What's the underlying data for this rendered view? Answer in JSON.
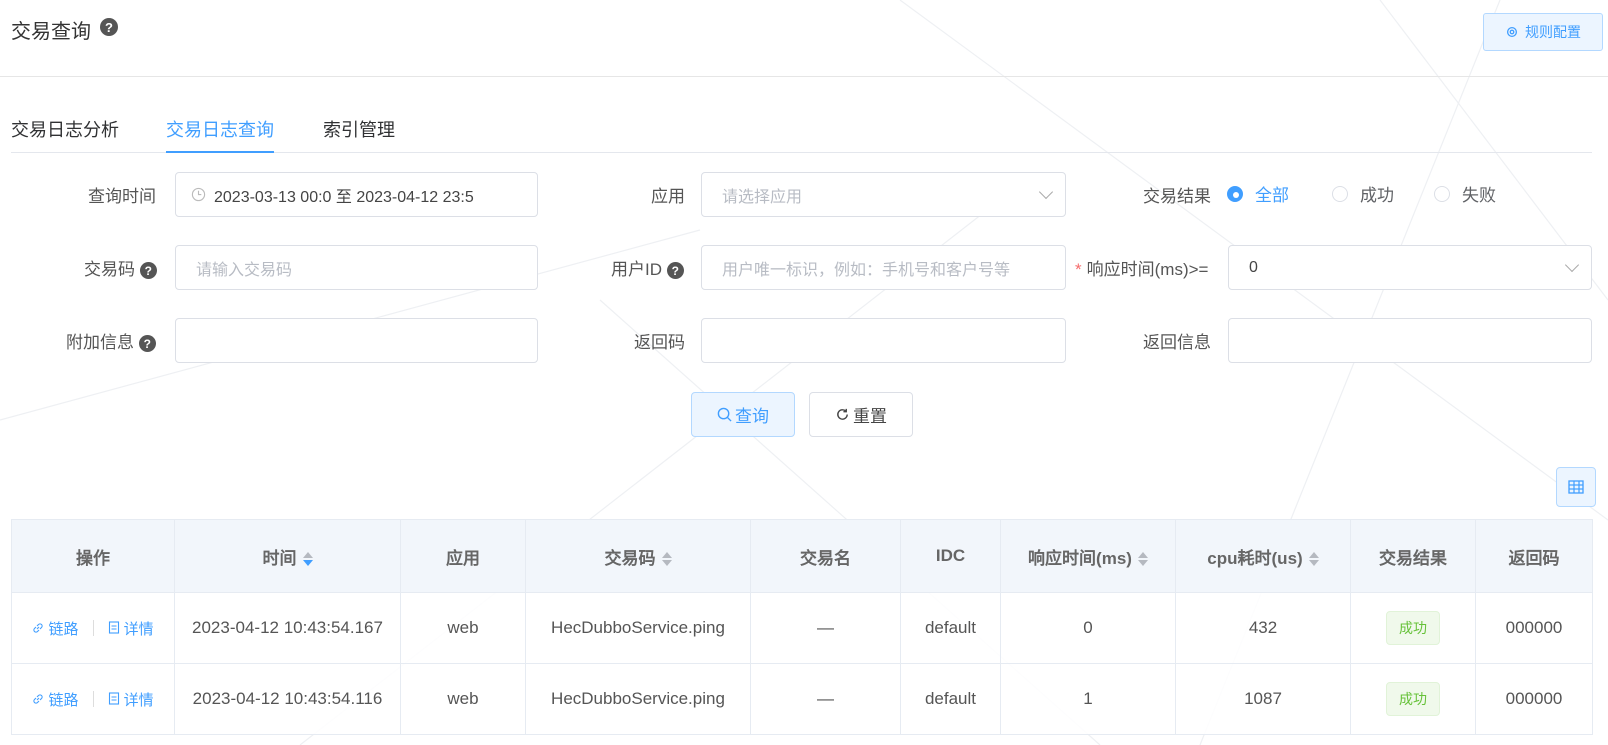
{
  "header": {
    "title": "交易查询",
    "rule_config_label": "规则配置"
  },
  "tabs": [
    {
      "label": "交易日志分析"
    },
    {
      "label": "交易日志查询"
    },
    {
      "label": "索引管理"
    }
  ],
  "form": {
    "query_time_label": "查询时间",
    "query_time_value": "2023-03-13 00:0  至  2023-04-12 23:5",
    "app_label": "应用",
    "app_placeholder": "请选择应用",
    "result_label": "交易结果",
    "result_options": [
      {
        "label": "全部",
        "checked": true
      },
      {
        "label": "成功",
        "checked": false
      },
      {
        "label": "失败",
        "checked": false
      }
    ],
    "txn_code_label": "交易码",
    "txn_code_placeholder": "请输入交易码",
    "user_id_label": "用户ID",
    "user_id_placeholder": "用户唯一标识，例如：手机号和客户号等",
    "resp_time_required": "*",
    "resp_time_label": "响应时间(ms)>=",
    "resp_time_value": "0",
    "extra_info_label": "附加信息",
    "return_code_label": "返回码",
    "return_info_label": "返回信息",
    "query_button": "查询",
    "reset_button": "重置"
  },
  "table": {
    "headers": [
      "操作",
      "时间",
      "应用",
      "交易码",
      "交易名",
      "IDC",
      "响应时间(ms)",
      "cpu耗时(us)",
      "交易结果",
      "返回码"
    ],
    "op_trace": "链路",
    "op_detail": "详情",
    "rows": [
      {
        "time": "2023-04-12 10:43:54.167",
        "app": "web",
        "code": "HecDubboService.ping",
        "name": "—",
        "idc": "default",
        "resp": "0",
        "cpu": "432",
        "result": "成功",
        "ret": "000000"
      },
      {
        "time": "2023-04-12 10:43:54.116",
        "app": "web",
        "code": "HecDubboService.ping",
        "name": "—",
        "idc": "default",
        "resp": "1",
        "cpu": "1087",
        "result": "成功",
        "ret": "000000"
      }
    ]
  },
  "colors": {
    "accent": "#409eff",
    "success": "#67c23a"
  }
}
